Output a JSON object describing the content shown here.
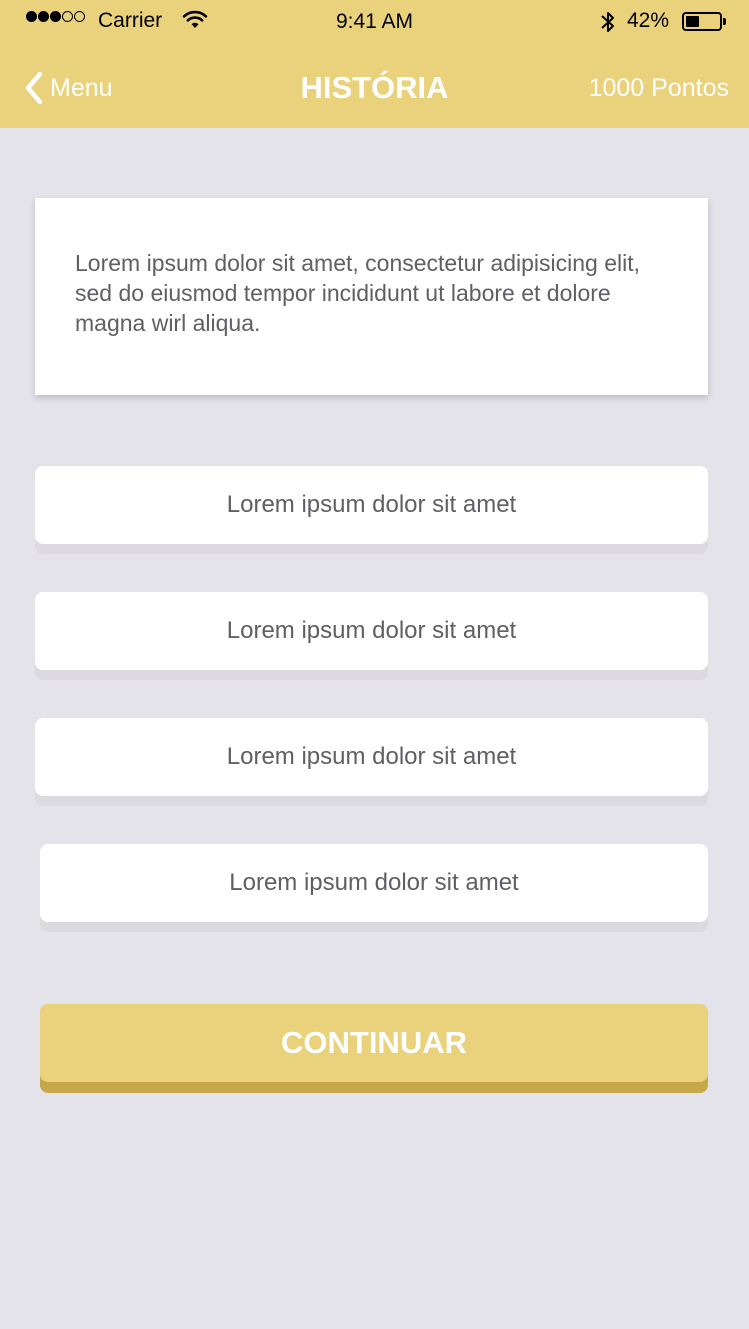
{
  "status_bar": {
    "carrier": "Carrier",
    "time": "9:41 AM",
    "battery_percent": "42%",
    "battery_level": 0.42,
    "signal_strength": 3,
    "signal_max": 5
  },
  "nav": {
    "back_label": "Menu",
    "title": "HISTÓRIA",
    "points": "1000 Pontos"
  },
  "story": {
    "text": "Lorem ipsum dolor sit amet, consectetur adipisicing elit, sed do eiusmod tempor incididunt ut labore et dolore magna wirl aliqua."
  },
  "options": [
    {
      "label": "Lorem ipsum dolor sit amet"
    },
    {
      "label": "Lorem ipsum dolor sit amet"
    },
    {
      "label": "Lorem ipsum dolor sit amet"
    },
    {
      "label": "Lorem ipsum dolor sit amet"
    }
  ],
  "continue_label": "CONTINUAR",
  "colors": {
    "brand_yellow": "#e9d27b",
    "background": "#e5e3ea",
    "text_gray": "#5f5f64"
  }
}
